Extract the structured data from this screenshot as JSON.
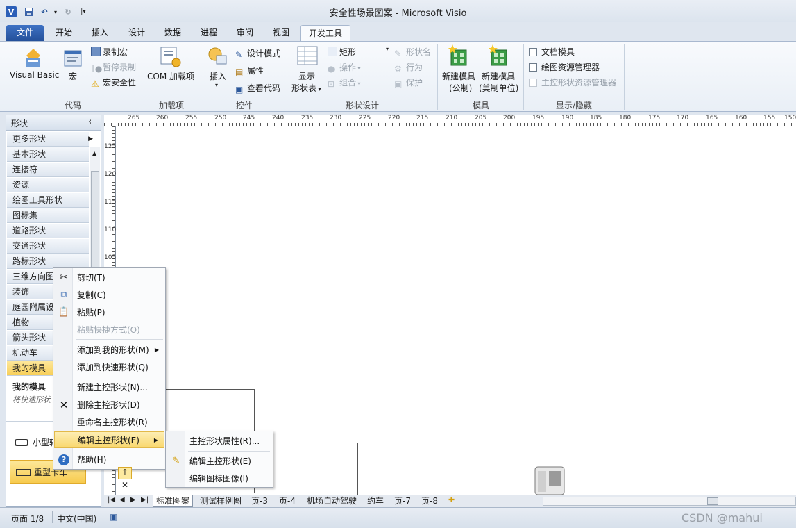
{
  "window": {
    "title": "安全性场景图案 - Microsoft Visio"
  },
  "tabs": [
    "文件",
    "开始",
    "插入",
    "设计",
    "数据",
    "进程",
    "审阅",
    "视图",
    "开发工具"
  ],
  "ribbon": {
    "code": {
      "label": "代码",
      "visual_basic": "Visual Basic",
      "macros": "宏",
      "record": "录制宏",
      "pause": "暂停录制",
      "security": "宏安全性"
    },
    "addins": {
      "label": "加载项",
      "com": "COM 加载项"
    },
    "controls": {
      "label": "控件",
      "insert": "插入",
      "design_mode": "设计模式",
      "properties": "属性",
      "view_code": "查看代码"
    },
    "shape_design": {
      "label": "形状设计",
      "show_shapesheet_1": "显示",
      "show_shapesheet_2": "形状表",
      "rectangle": "矩形",
      "operations": "操作",
      "group": "组合",
      "shape_name": "形状名",
      "behavior": "行为",
      "protection": "保护"
    },
    "stencil": {
      "label": "模具",
      "new_metric_1": "新建模具",
      "new_metric_2": "(公制)",
      "new_us_1": "新建模具",
      "new_us_2": "(美制单位)"
    },
    "show_hide": {
      "label": "显示/隐藏",
      "doc_stencil": "文档模具",
      "drawing_explorer": "绘图资源管理器",
      "master_explorer": "主控形状资源管理器"
    }
  },
  "shapes_panel": {
    "title": "形状",
    "stencils": [
      "更多形状",
      "基本形状",
      "连接符",
      "资源",
      "绘图工具形状",
      "图标集",
      "道路形状",
      "交通形状",
      "路标形状",
      "三维方向图",
      "装饰",
      "庭园附属设",
      "植物",
      "箭头形状",
      "机动车",
      "我的模具"
    ],
    "my_stencil_title": "我的模具",
    "quick_shapes_hint": "将快速形状",
    "item_small": "小型轿",
    "item_heavy": "重型卡车"
  },
  "ruler": {
    "h_ticks": [
      "265",
      "260",
      "255",
      "250",
      "245",
      "240",
      "235",
      "230",
      "225",
      "220",
      "215",
      "210",
      "205",
      "200",
      "195",
      "190",
      "185",
      "180",
      "175",
      "170",
      "165",
      "160",
      "155",
      "150"
    ],
    "v_ticks": [
      "125",
      "120",
      "115",
      "110",
      "105"
    ]
  },
  "context_menu": {
    "items": [
      "剪切(T)",
      "复制(C)",
      "粘贴(P)",
      "粘贴快捷方式(O)",
      "添加到我的形状(M)",
      "添加到快速形状(Q)",
      "新建主控形状(N)...",
      "删除主控形状(D)",
      "重命名主控形状(R)",
      "编辑主控形状(E)",
      "帮助(H)"
    ],
    "submenu": [
      "主控形状属性(R)...",
      "编辑主控形状(E)",
      "编辑图标图像(I)"
    ]
  },
  "page_tabs": [
    "标准图案",
    "测试样例图",
    "页-3",
    "页-4",
    "机场自动驾驶",
    "约车",
    "页-7",
    "页-8"
  ],
  "status": {
    "page": "页面 1/8",
    "language": "中文(中国)"
  },
  "watermark": "CSDN @mahui"
}
